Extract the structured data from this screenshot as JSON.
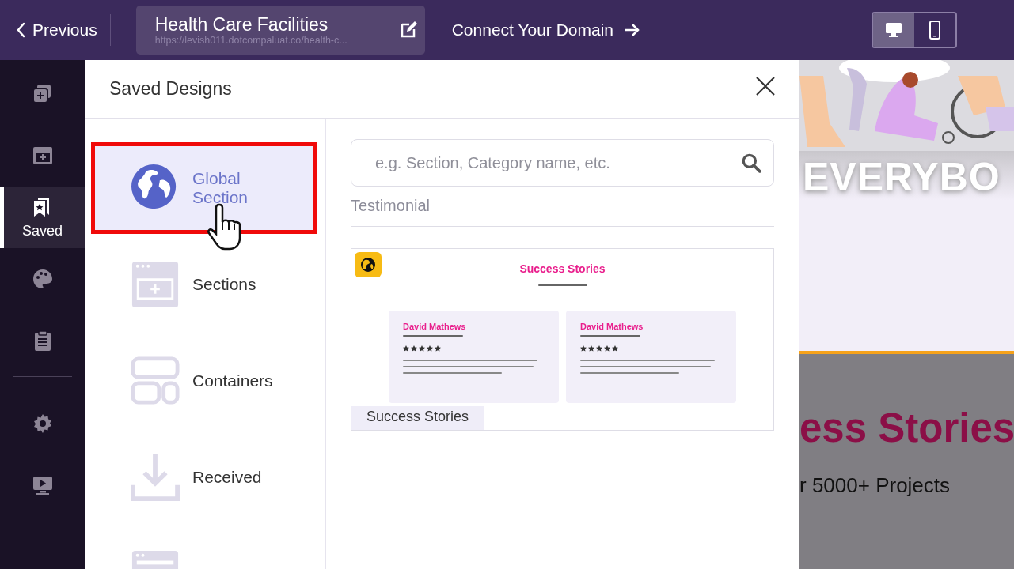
{
  "topbar": {
    "back_label": "Previous",
    "page_title": "Health Care Facilities",
    "page_url": "https://levish011.dotcompaluat.co/health-c...",
    "connect_label": "Connect Your Domain",
    "devices": [
      {
        "kind": "desktop",
        "selected": true
      },
      {
        "kind": "mobile",
        "selected": false
      }
    ]
  },
  "rail": [
    {
      "kind": "add-page",
      "selected": false
    },
    {
      "kind": "add-section",
      "selected": false
    },
    {
      "kind": "saved",
      "label": "Saved",
      "selected": true
    },
    {
      "kind": "theme",
      "selected": false
    },
    {
      "kind": "forms",
      "selected": false
    },
    {
      "kind": "divider"
    },
    {
      "kind": "settings",
      "selected": false
    },
    {
      "kind": "preview",
      "selected": false
    }
  ],
  "panel": {
    "title": "Saved Designs",
    "categories": [
      {
        "kind": "global",
        "label": "Global Section",
        "selected": true,
        "highlighted": true
      },
      {
        "kind": "sections",
        "label": "Sections",
        "selected": false,
        "highlighted": false
      },
      {
        "kind": "containers",
        "label": "Containers",
        "selected": false,
        "highlighted": false
      },
      {
        "kind": "received",
        "label": "Received",
        "selected": false,
        "highlighted": false
      },
      {
        "kind": "headers",
        "selected": false,
        "highlighted": false
      }
    ],
    "search": {
      "placeholder": "e.g. Section, Category name, etc."
    },
    "group_title": "Testimonial",
    "designs": [
      {
        "name": "Success Stories",
        "global": true,
        "thumb_title": "Success Stories",
        "testimonials": [
          {
            "name": "David Mathews",
            "stars": 5
          },
          {
            "name": "David Mathews",
            "stars": 5
          }
        ]
      }
    ]
  },
  "site_preview": {
    "banner_text": "EVERYBO",
    "heading": "ess Stories",
    "subheading": "r 5000+ Projects"
  }
}
